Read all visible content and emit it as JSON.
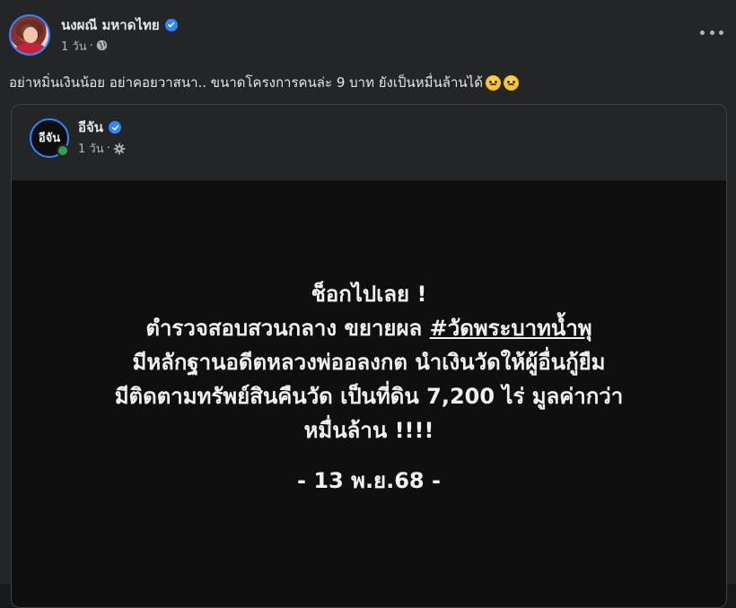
{
  "post": {
    "author": "นงผณี มหาดไทย",
    "time": "1 วัน",
    "separator": "·",
    "caption_text": "อย่าหมิ่นเงินน้อย อย่าคอยวาสนา.. ขนาดโครงการคนล่ะ 9 บาท ยังเป็นหมื่นล้านได้",
    "caption_emojis": [
      "sad-face-emoji",
      "worried-face-emoji"
    ]
  },
  "shared": {
    "author": "อีจัน",
    "avatar_text": "อีจัน",
    "time": "1 วัน",
    "separator": "·"
  },
  "image_text": {
    "line1": "ช็อกไปเลย !",
    "line2_prefix": "ตำรวจสอบสวนกลาง ขยายผล ",
    "line2_hashtag": "#วัดพระบาทน้ำพุ",
    "line3": "มีหลักฐานอดีตหลวงพ่ออลงกต นำเงินวัดให้ผู้อื่นกู้ยืม",
    "line4": "มีติดตามทรัพย์สินคืนวัด เป็นที่ดิน 7,200 ไร่ มูลค่ากว่า",
    "line5": "หมื่นล้าน !!!!",
    "date": "- 13 พ.ย.68 -"
  },
  "colors": {
    "accent_blue": "#2d88ff",
    "online_green": "#31a24c",
    "card_bg": "#242526",
    "image_bg": "#0f0f0f"
  }
}
